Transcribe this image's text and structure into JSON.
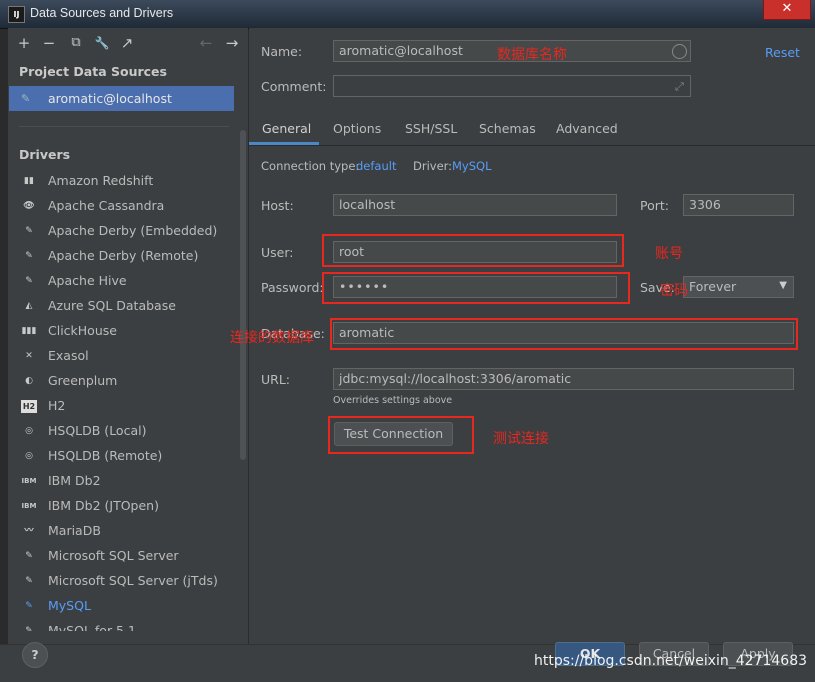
{
  "window": {
    "title": "Data Sources and Drivers",
    "app_icon": "IJ",
    "close": "✕"
  },
  "toolbar": {
    "add": "+",
    "remove": "−",
    "copy": "⧉",
    "wrench": "🔧",
    "jump": "↗",
    "back": "←",
    "forward": "→"
  },
  "sidebar": {
    "project_header": "Project Data Sources",
    "project_items": [
      {
        "label": "aromatic@localhost"
      }
    ],
    "drivers_header": "Drivers",
    "drivers": [
      {
        "label": "Amazon Redshift",
        "icon": "▮▮"
      },
      {
        "label": "Apache Cassandra",
        "icon": "👁"
      },
      {
        "label": "Apache Derby (Embedded)",
        "icon": "✎"
      },
      {
        "label": "Apache Derby (Remote)",
        "icon": "✎"
      },
      {
        "label": "Apache Hive",
        "icon": "✎"
      },
      {
        "label": "Azure SQL Database",
        "icon": "◭"
      },
      {
        "label": "ClickHouse",
        "icon": "▮▮▮"
      },
      {
        "label": "Exasol",
        "icon": "✕"
      },
      {
        "label": "Greenplum",
        "icon": "◐"
      },
      {
        "label": "H2",
        "icon": "H2"
      },
      {
        "label": "HSQLDB (Local)",
        "icon": "◎"
      },
      {
        "label": "HSQLDB (Remote)",
        "icon": "◎"
      },
      {
        "label": "IBM Db2",
        "icon": "IBM"
      },
      {
        "label": "IBM Db2 (JTOpen)",
        "icon": "IBM"
      },
      {
        "label": "MariaDB",
        "icon": "〰"
      },
      {
        "label": "Microsoft SQL Server",
        "icon": "✎"
      },
      {
        "label": "Microsoft SQL Server (jTds)",
        "icon": "✎"
      },
      {
        "label": "MySQL",
        "icon": "✎"
      },
      {
        "label": "MySQL for 5.1",
        "icon": "✎"
      }
    ]
  },
  "form": {
    "name_label": "Name:",
    "name_value": "aromatic@localhost",
    "reset": "Reset",
    "comment_label": "Comment:",
    "comment_value": "",
    "tabs": [
      "General",
      "Options",
      "SSH/SSL",
      "Schemas",
      "Advanced"
    ],
    "connection_type_label": "Connection type:",
    "connection_type_value": "default",
    "driver_label": "Driver:",
    "driver_value": "MySQL",
    "host_label": "Host:",
    "host_value": "localhost",
    "port_label": "Port:",
    "port_value": "3306",
    "user_label": "User:",
    "user_value": "root",
    "password_label": "Password:",
    "password_value": "••••••",
    "save_label": "Save:",
    "save_value": "Forever",
    "database_label": "Database:",
    "database_value": "aromatic",
    "url_label": "URL:",
    "url_value": "jdbc:mysql://localhost:3306/aromatic",
    "url_hint": "Overrides settings above",
    "test_connection": "Test Connection"
  },
  "annotations": {
    "db_name": "数据库名称",
    "account": "账号",
    "password": "密码",
    "database": "连接的数据库",
    "test": "测试连接"
  },
  "footer": {
    "help": "?",
    "ok": "OK",
    "cancel": "Cancel",
    "apply": "Apply"
  },
  "watermark": "https://blog.csdn.net/weixin_42714683"
}
